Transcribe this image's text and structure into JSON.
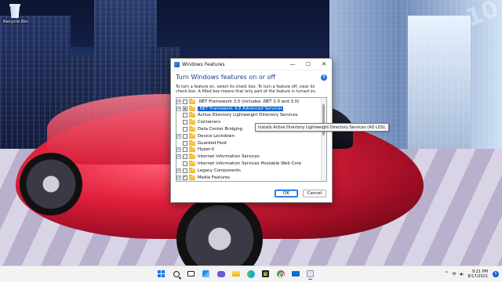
{
  "desktop": {
    "icons": [
      {
        "label": "Recycle Bin",
        "icon": "recycle-bin-icon"
      }
    ],
    "corner_text": "10"
  },
  "dialog": {
    "title": "Windows Features",
    "heading": "Turn Windows features on or off",
    "help": "?",
    "description": "To turn a feature on, select its check box. To turn a feature off, clear its check box. A filled box means that only part of the feature is turned on.",
    "controls": {
      "minimize": "—",
      "maximize": "☐",
      "close": "✕"
    },
    "features": [
      {
        "label": ".NET Framework 3.5 (includes .NET 2.0 and 3.0)",
        "expandable": true,
        "state": "unchecked",
        "selected": false
      },
      {
        "label": ".NET Framework 4.8 Advanced Services",
        "expandable": true,
        "state": "filled",
        "selected": true
      },
      {
        "label": "Active Directory Lightweight Directory Services",
        "expandable": false,
        "state": "unchecked",
        "selected": false
      },
      {
        "label": "Containers",
        "expandable": false,
        "state": "unchecked",
        "selected": false
      },
      {
        "label": "Data Center Bridging",
        "expandable": false,
        "state": "unchecked",
        "selected": false
      },
      {
        "label": "Device Lockdown",
        "expandable": true,
        "state": "unchecked",
        "selected": false
      },
      {
        "label": "Guarded Host",
        "expandable": false,
        "state": "unchecked",
        "selected": false
      },
      {
        "label": "Hyper-V",
        "expandable": true,
        "state": "unchecked",
        "selected": false
      },
      {
        "label": "Internet Information Services",
        "expandable": true,
        "state": "unchecked",
        "selected": false
      },
      {
        "label": "Internet Information Services Hostable Web Core",
        "expandable": false,
        "state": "unchecked",
        "selected": false
      },
      {
        "label": "Legacy Components",
        "expandable": true,
        "state": "unchecked",
        "selected": false
      },
      {
        "label": "Media Features",
        "expandable": true,
        "state": "checked",
        "selected": false
      }
    ],
    "tooltip": "Installs Active Directory Lightweight Directory Services (AD LDS).",
    "ok_label": "OK",
    "cancel_label": "Cancel"
  },
  "taskbar": {
    "apps": [
      {
        "name": "start-button",
        "icon": "windows-start-icon",
        "active": false
      },
      {
        "name": "search-button",
        "icon": "search-icon",
        "active": false
      },
      {
        "name": "task-view-button",
        "icon": "task-view-icon",
        "active": false
      },
      {
        "name": "widgets-button",
        "icon": "widgets-icon",
        "active": false
      },
      {
        "name": "chat-button",
        "icon": "chat-icon",
        "active": false
      },
      {
        "name": "file-explorer-button",
        "icon": "folder-icon",
        "active": false
      },
      {
        "name": "edge-button",
        "icon": "edge-icon",
        "active": false
      },
      {
        "name": "store-button",
        "icon": "store-icon",
        "active": false
      },
      {
        "name": "chrome-button",
        "icon": "chrome-icon",
        "active": false
      },
      {
        "name": "mail-button",
        "icon": "mail-icon",
        "active": false
      },
      {
        "name": "windows-features-button",
        "icon": "windows-features-icon",
        "active": true
      }
    ],
    "tray": {
      "chevron": "^",
      "time": "9:21 PM",
      "date": "8/17/2021",
      "notifications": "5"
    }
  },
  "colors": {
    "accent": "#0a5fd6",
    "heading": "#1c3e8a",
    "car_red": "#e0203c"
  }
}
